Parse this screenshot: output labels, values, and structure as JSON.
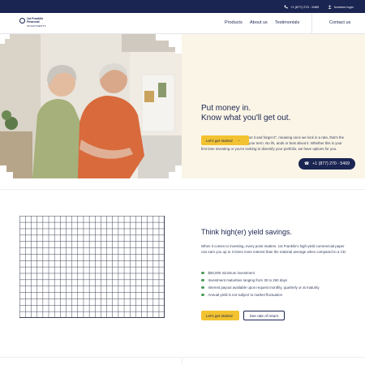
{
  "topbar": {
    "phone": "+1 (877) 270 - 5469",
    "login": "Investor login"
  },
  "logo": {
    "line1": "1st Franklin",
    "line2": "Financial",
    "line3": "INVESTMENTS"
  },
  "nav": {
    "items": [
      "Products",
      "About us",
      "Testimonials"
    ],
    "contact": "Contact us"
  },
  "hero": {
    "title_line1": "Put money in.",
    "title_line2": "Know what you'll get out.",
    "body": "1st Franklin investments are \"set it and forget it\", meaning once we lock in a rate, that's the rate you receive at the end of your term. No ifs, ands or buts about it. Whether this is your first time investing or you're looking to diversify your portfolio, we have options for you.",
    "cta": "Let's get started",
    "call": "+1 (877) 270 - 5469"
  },
  "savings": {
    "title": "Think high(er) yield savings.",
    "body": "When it comes to investing, every point matters. 1st Franklin's high-yield commercial paper can earn you up to 3 times more interest than the national average when compared to a CD.",
    "bullets": [
      "$50,000 minimum investment",
      "Investment maturities ranging from 30 to 260 days",
      "Interest payout available upon request monthly, quarterly or at maturity",
      "Annual yield is not subject to market fluctuation"
    ],
    "cta": "Let's get started",
    "secondary": "See rate of return"
  },
  "colors": {
    "navy": "#1b2552",
    "cream": "#faf5e6",
    "yellow": "#f2c230",
    "bullet_green": "#4a9a5a"
  }
}
